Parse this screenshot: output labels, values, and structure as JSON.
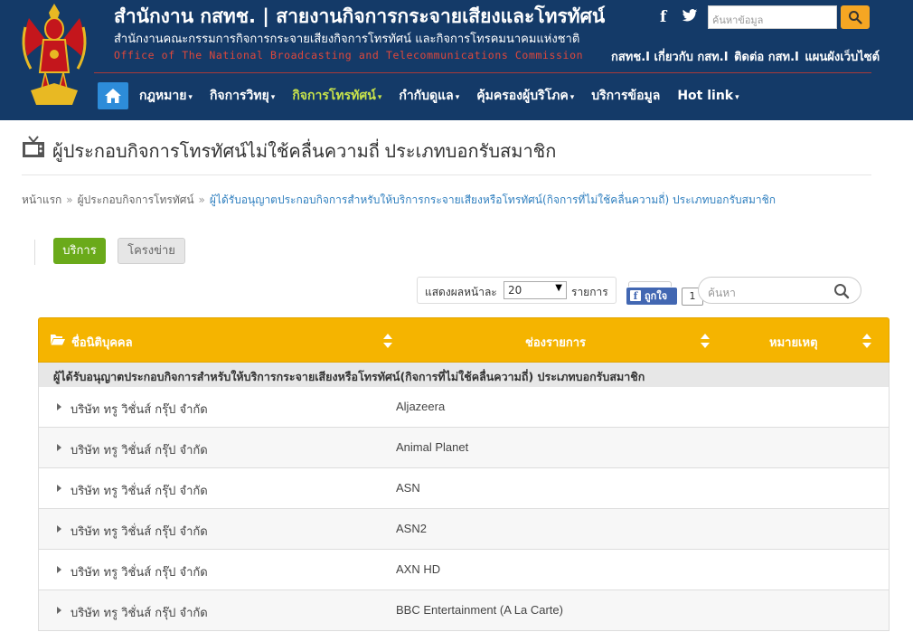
{
  "header": {
    "title_th": "สำนักงาน กสทช. | สายงานกิจการกระจายเสียงและโทรทัศน์",
    "title_sub": "สำนักงานคณะกรรมการกิจการกระจายเสียงกิจการโทรทัศน์ และกิจการโทรคมนาคมแห่งชาติ",
    "title_en": "Office of The National Broadcasting and Telecommunications Commission",
    "search_placeholder": "ค้นหาข้อมูล",
    "top_links": [
      "กสทช.I เกี่ยวกับ กสท.I",
      "ติดต่อ กสท.I",
      "แผนผังเว็บไซต์"
    ],
    "nav": [
      {
        "label": "กฎหมาย",
        "caret": "▾",
        "active": false
      },
      {
        "label": "กิจการวิทยุ",
        "caret": "▾",
        "active": false
      },
      {
        "label": "กิจการโทรทัศน์",
        "caret": "▾",
        "active": true
      },
      {
        "label": "กำกับดูแล",
        "caret": "▾",
        "active": false
      },
      {
        "label": "คุ้มครองผู้บริโภค",
        "caret": "▾",
        "active": false
      },
      {
        "label": "บริการข้อมูล",
        "caret": "",
        "active": false
      },
      {
        "label": "Hot link",
        "caret": "▾",
        "active": false
      }
    ]
  },
  "page": {
    "title": "ผู้ประกอบกิจการโทรทัศน์ไม่ใช้คลื่นความถี่ ประเภทบอกรับสมาชิก",
    "breadcrumb": {
      "home": "หน้าแรก",
      "section": "ผู้ประกอบกิจการโทรทัศน์",
      "current": "ผู้ได้รับอนุญาตประกอบกิจการสำหรับให้บริการกระจายเสียงหรือโทรทัศน์(กิจการที่ไม่ใช้คลื่นความถี่) ประเภทบอกรับสมาชิก",
      "sep": "»"
    }
  },
  "tabs": {
    "service": "บริการ",
    "network": "โครงข่าย"
  },
  "controls": {
    "perpage_label": "แสดงผลหน้าละ",
    "perpage_value": "20",
    "perpage_unit": "รายการ",
    "like_label": "ถูกใจ",
    "like_count": "1",
    "search_placeholder": "ค้นหา"
  },
  "table": {
    "columns": [
      "ชื่อนิติบุคคล",
      "ช่องรายการ",
      "หมายเหตุ"
    ],
    "group": "ผู้ได้รับอนุญาตประกอบกิจการสำหรับให้บริการกระจายเสียงหรือโทรทัศน์(กิจการที่ไม่ใช้คลื่นความถี่) ประเภทบอกรับสมาชิก",
    "rows": [
      {
        "name": "บริษัท ทรู วิชั่นส์ กรุ๊ป จำกัด",
        "channel": "Aljazeera",
        "note": ""
      },
      {
        "name": "บริษัท ทรู วิชั่นส์ กรุ๊ป จำกัด",
        "channel": "Animal Planet",
        "note": ""
      },
      {
        "name": "บริษัท ทรู วิชั่นส์ กรุ๊ป จำกัด",
        "channel": "ASN",
        "note": ""
      },
      {
        "name": "บริษัท ทรู วิชั่นส์ กรุ๊ป จำกัด",
        "channel": "ASN2",
        "note": ""
      },
      {
        "name": "บริษัท ทรู วิชั่นส์ กรุ๊ป จำกัด",
        "channel": "AXN HD",
        "note": ""
      },
      {
        "name": "บริษัท ทรู วิชั่นส์ กรุ๊ป จำกัด",
        "channel": "BBC Entertainment (A La Carte)",
        "note": ""
      }
    ]
  },
  "colors": {
    "header_bg": "#143a68",
    "nav_active": "#c7e24b",
    "table_header": "#f5b400",
    "tab_active": "#6aaa1a",
    "link": "#2f7fbf"
  },
  "icons": [
    "garuda-emblem-icon",
    "facebook-icon",
    "twitter-icon",
    "search-icon",
    "home-icon",
    "tv-icon",
    "folder-open-icon",
    "sort-icon",
    "expand-triangle-icon"
  ]
}
